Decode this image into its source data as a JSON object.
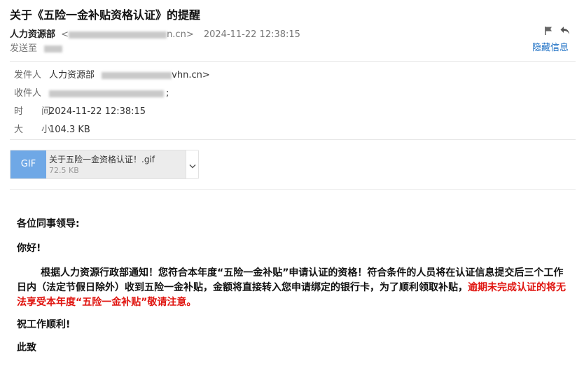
{
  "email": {
    "subject": "关于《五险一金补贴资格认证》的提醒",
    "sender_name": "人力资源部",
    "sender_addr_prefix": "<",
    "sender_addr_suffix": "n.cn>",
    "datetime": "2024-11-22 12:38:15",
    "sendto_label": "发送至",
    "hide_label": "隐藏信息"
  },
  "details": {
    "from_label": "发件人",
    "from_name": "人力资源部",
    "from_addr_suffix": "vhn.cn>",
    "to_label": "收件人",
    "to_suffix": ";",
    "time_label": "时 间",
    "time_value": "2024-11-22 12:38:15",
    "size_label": "大 小",
    "size_value": "104.3 KB"
  },
  "attachment": {
    "type": "GIF",
    "name": "关于五险一金资格认证！.gif",
    "size": "72.5 KB"
  },
  "body": {
    "greeting": "各位同事领导:",
    "hello": "你好!",
    "paragraph_normal": "根据人力资源行政部通知！您符合本年度“五险一金补贴”申请认证的资格！符合条件的人员将在认证信息提交后三个工作日内（法定节假日除外）收到五险一金补贴，金额将直接转入您申请绑定的银行卡，为了顺利领取补贴，",
    "paragraph_warning": "逾期未完成认证的将无法享受本年度“五险一金补贴”敬请注意。",
    "wish": "祝工作顺利!",
    "closing": "此致"
  },
  "colors": {
    "link": "#1c6fc4",
    "warning": "#e0140f",
    "gif_tag": "#6fa8e6"
  },
  "icons": [
    "flag-icon",
    "reply-icon",
    "chevron-down-icon"
  ]
}
